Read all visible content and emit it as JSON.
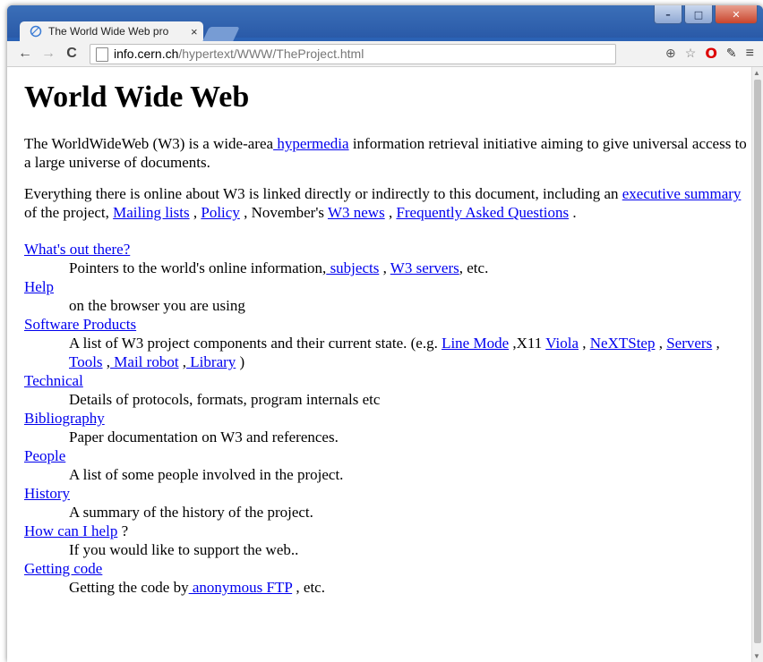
{
  "browser": {
    "tab_title": "The World Wide Web pro",
    "tab_close": "×",
    "address_host": "info.cern.ch",
    "address_path": "/hypertext/WWW/TheProject.html",
    "controls": {
      "minimize": "–",
      "maximize": "□",
      "close": "✕"
    },
    "nav": {
      "back": "←",
      "forward": "→",
      "reload": "C"
    },
    "icons": {
      "zoom": "⊕",
      "star": "☆",
      "opera": "O",
      "dropper": "✎",
      "menu": "≡"
    }
  },
  "page": {
    "title": "World Wide Web",
    "p1": {
      "t1": "The WorldWideWeb (W3) is a wide-area",
      "link_hypermedia": " hypermedia",
      "t2": " information retrieval initiative aiming to give universal access to a large universe of documents."
    },
    "p2": {
      "t1": "Everything there is online about W3 is linked directly or indirectly to this document, including an ",
      "link_exec": "executive summary",
      "t2": " of the project, ",
      "link_mailing": "Mailing lists",
      "t3": " , ",
      "link_policy": "Policy",
      "t4": " , November's ",
      "link_news": "W3 news",
      "t5": " , ",
      "link_faq": "Frequently Asked Questions",
      "t6": " ."
    },
    "items": {
      "whats_out": {
        "link": "What's out there?",
        "d1": "Pointers to the world's online information,",
        "l1": " subjects",
        "d2": " , ",
        "l2": "W3 servers",
        "d3": ", etc."
      },
      "help": {
        "link": "Help",
        "desc": "on the browser you are using"
      },
      "software": {
        "link": "Software Products",
        "d1": "A list of W3 project components and their current state. (e.g. ",
        "l_linemode": "Line Mode",
        "d2": " ,X11 ",
        "l_viola": "Viola",
        "d3": " , ",
        "l_nextstep": "NeXTStep",
        "d4": " , ",
        "l_servers": "Servers",
        "d5": " , ",
        "l_tools": "Tools",
        "d6": " ,",
        "l_mailrobot": " Mail robot",
        "d7": " ,",
        "l_library": " Library",
        "d8": " )"
      },
      "technical": {
        "link": "Technical",
        "desc": "Details of protocols, formats, program internals etc"
      },
      "bibliography": {
        "link": "Bibliography",
        "desc": "Paper documentation on W3 and references."
      },
      "people": {
        "link": "People",
        "desc": "A list of some people involved in the project."
      },
      "history": {
        "link": "History",
        "desc": "A summary of the history of the project."
      },
      "howhelp": {
        "link": "How can I help",
        "suffix": " ?",
        "desc": "If you would like to support the web.."
      },
      "getcode": {
        "link": "Getting code",
        "d1": "Getting the code by",
        "l_ftp": " anonymous FTP",
        "d2": " , etc."
      }
    }
  }
}
